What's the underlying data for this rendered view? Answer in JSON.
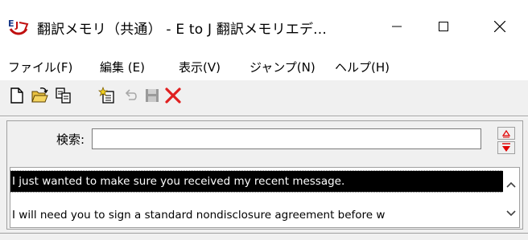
{
  "window": {
    "title": "翻訳メモリ（共通） - E to J 翻訳メモリエデ...",
    "app_icon": "ej-app-icon",
    "controls": [
      "minimize-icon",
      "maximize-icon",
      "close-icon"
    ]
  },
  "menu": {
    "items": [
      {
        "label": "ファイル(F)"
      },
      {
        "label": "編集 (E)"
      },
      {
        "label": "表示(V)"
      },
      {
        "label": "ジャンプ(N)"
      },
      {
        "label": "ヘルプ(H)"
      }
    ]
  },
  "toolbar": {
    "buttons": [
      {
        "icon": "new-document-icon",
        "enabled": true
      },
      {
        "icon": "open-folder-icon",
        "enabled": true
      },
      {
        "icon": "copy-icon",
        "enabled": true
      },
      {
        "icon": "add-entry-icon",
        "enabled": true
      },
      {
        "icon": "undo-icon",
        "enabled": false
      },
      {
        "icon": "save-icon",
        "enabled": false
      },
      {
        "icon": "delete-icon",
        "enabled": true,
        "color": "#e02020"
      }
    ]
  },
  "search": {
    "label": "検索:",
    "value": ""
  },
  "results": {
    "rows": [
      {
        "text": "I just wanted to make sure you received my recent message.",
        "selected": true
      },
      {
        "text": "I will need you to sign a standard nondisclosure agreement before w",
        "selected": false
      }
    ]
  },
  "colors": {
    "selection_bg": "#000000",
    "selection_fg": "#ffffff",
    "nav_arrow": "#e00000",
    "window_bg": "#f0f0f0"
  }
}
